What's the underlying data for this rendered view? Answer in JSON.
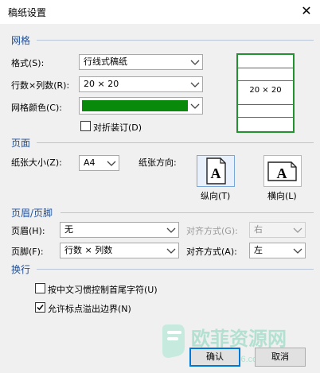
{
  "title": "稿纸设置",
  "close_glyph": "✕",
  "grid": {
    "section_title": "网格",
    "format_label": "格式(S):",
    "format_value": "行线式稿纸",
    "rows_cols_label": "行数×列数(R):",
    "rows_cols_value": "20 × 20",
    "color_label": "网格颜色(C):",
    "color_value": "#0a8a0a",
    "fold_label": "对折装订(D)",
    "fold_checked": false,
    "preview_text": "20 × 20",
    "preview_color": "#22912f"
  },
  "page": {
    "section_title": "页面",
    "size_label": "纸张大小(Z):",
    "size_value": "A4",
    "orientation_label": "纸张方向:",
    "portrait_label": "纵向(T)",
    "landscape_label": "横向(L)",
    "orientation_selected": "portrait",
    "icon_letter": "A"
  },
  "header_footer": {
    "section_title": "页眉/页脚",
    "header_label": "页眉(H):",
    "header_value": "无",
    "header_align_label": "对齐方式(G):",
    "header_align_value": "右",
    "header_align_disabled": true,
    "footer_label": "页脚(F):",
    "footer_value": "行数 × 列数",
    "footer_align_label": "对齐方式(A):",
    "footer_align_value": "左"
  },
  "wrap": {
    "section_title": "换行",
    "option1_label": "按中文习惯控制首尾字符(U)",
    "option1_checked": false,
    "option2_label": "允许标点溢出边界(N)",
    "option2_checked": true
  },
  "buttons": {
    "ok_label": "确认",
    "cancel_label": "取消"
  },
  "watermark": {
    "text": "欧菲资源网",
    "url": "www.office26.com"
  },
  "colors": {
    "section_heading": "#1f4f9a",
    "accent": "#0078d7"
  }
}
